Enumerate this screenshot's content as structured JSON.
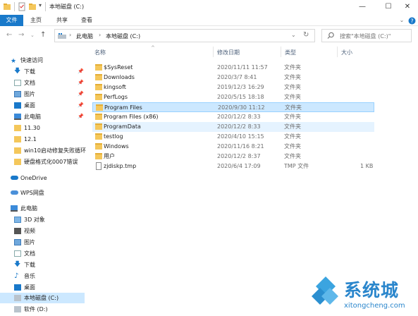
{
  "window": {
    "title": "本地磁盘 (C:)",
    "minimize": "—",
    "maximize": "☐",
    "close": "✕"
  },
  "ribbon": {
    "tabs": [
      "文件",
      "主页",
      "共享",
      "查看"
    ]
  },
  "address": {
    "path": [
      "此电脑",
      "本地磁盘 (C:)"
    ],
    "search_placeholder": "搜索\"本地磁盘 (C:)\""
  },
  "nav": {
    "quick_access": "快速访问",
    "pinned": [
      "下载",
      "文档",
      "图片",
      "桌面",
      "此电脑"
    ],
    "recent": [
      "11.30",
      "12.1",
      "win10启动修复失败循环",
      "硬盘格式化0007错误"
    ],
    "onedrive": "OneDrive",
    "wps": "WPS网盘",
    "this_pc": "此电脑",
    "pc_items": [
      "3D 对象",
      "视频",
      "图片",
      "文档",
      "下载",
      "音乐",
      "桌面",
      "本地磁盘 (C:)",
      "软件 (D:)"
    ]
  },
  "columns": {
    "name": "名称",
    "date": "修改日期",
    "type": "类型",
    "size": "大小"
  },
  "files": [
    {
      "name": "$SysReset",
      "date": "2020/11/11 11:57",
      "type": "文件夹",
      "size": ""
    },
    {
      "name": "Downloads",
      "date": "2020/3/7 8:41",
      "type": "文件夹",
      "size": ""
    },
    {
      "name": "kingsoft",
      "date": "2019/12/3 16:29",
      "type": "文件夹",
      "size": ""
    },
    {
      "name": "PerfLogs",
      "date": "2020/5/15 18:18",
      "type": "文件夹",
      "size": ""
    },
    {
      "name": "Program Files",
      "date": "2020/9/30 11:12",
      "type": "文件夹",
      "size": ""
    },
    {
      "name": "Program Files (x86)",
      "date": "2020/12/2 8:33",
      "type": "文件夹",
      "size": ""
    },
    {
      "name": "ProgramData",
      "date": "2020/12/2 8:33",
      "type": "文件夹",
      "size": ""
    },
    {
      "name": "testlog",
      "date": "2020/4/10 15:15",
      "type": "文件夹",
      "size": ""
    },
    {
      "name": "Windows",
      "date": "2020/11/16 8:21",
      "type": "文件夹",
      "size": ""
    },
    {
      "name": "用户",
      "date": "2020/12/2 8:37",
      "type": "文件夹",
      "size": ""
    },
    {
      "name": "zjdiskp.tmp",
      "date": "2020/6/4 17:09",
      "type": "TMP 文件",
      "size": "1 KB"
    }
  ],
  "watermark": {
    "brand": "系统城",
    "url": "xitongcheng.com"
  },
  "colors": {
    "accent": "#1979ca",
    "selected_row": "#cce8ff",
    "hover_row": "#e5f3ff",
    "folder": "#f4c75b"
  }
}
